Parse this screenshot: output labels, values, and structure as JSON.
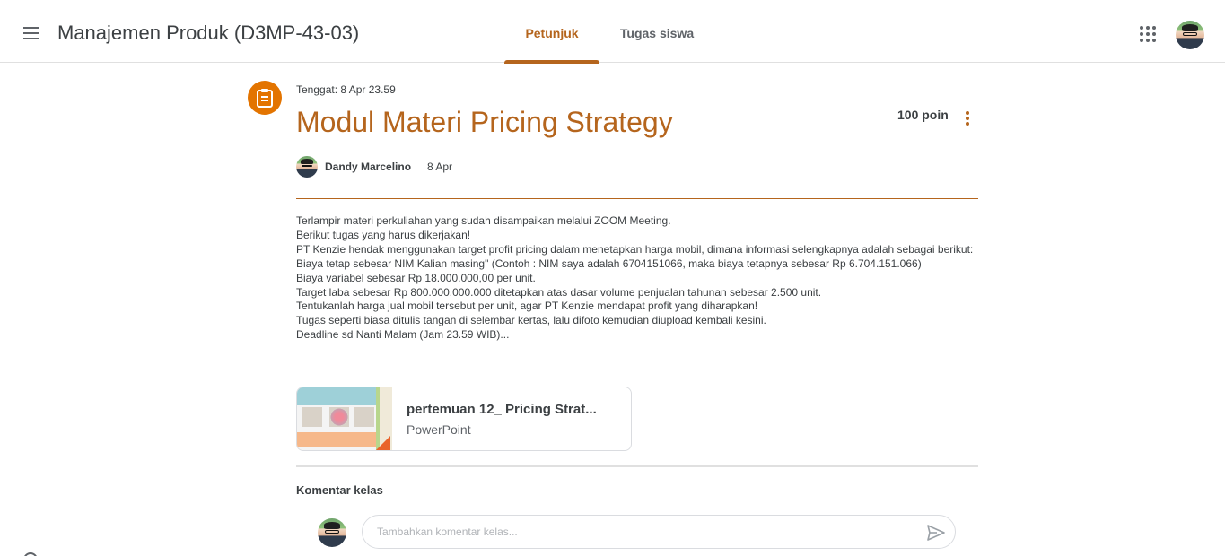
{
  "header": {
    "course_title": "Manajemen Produk (D3MP-43-03)",
    "tabs": [
      {
        "label": "Petunjuk",
        "active": true
      },
      {
        "label": "Tugas siswa",
        "active": false
      }
    ],
    "menu_icon": "hamburger-menu-icon",
    "apps_icon": "apps-grid-icon"
  },
  "assignment": {
    "icon": "assignment-icon",
    "due": "Tenggat: 8 Apr 23.59",
    "title": "Modul Materi Pricing Strategy",
    "points": "100 poin",
    "author": "Dandy Marcelino",
    "date": "8 Apr",
    "body": [
      "Terlampir materi perkuliahan yang sudah disampaikan melalui ZOOM Meeting.",
      "Berikut tugas yang harus dikerjakan!",
      "PT Kenzie hendak menggunakan target profit pricing dalam menetapkan harga mobil, dimana informasi selengkapnya adalah sebagai berikut:",
      "Biaya tetap sebesar NIM Kalian masing\" (Contoh : NIM saya adalah 6704151066, maka biaya tetapnya sebesar Rp 6.704.151.066)",
      "Biaya variabel sebesar Rp 18.000.000,00 per unit.",
      "Target laba sebesar Rp 800.000.000.000 ditetapkan atas dasar volume penjualan tahunan sebesar 2.500 unit.",
      "Tentukanlah harga jual mobil tersebut per unit, agar PT Kenzie mendapat profit yang diharapkan!",
      "",
      "Tugas seperti biasa ditulis tangan di selembar kertas, lalu difoto kemudian diupload kembali kesini.",
      "Deadline sd Nanti Malam (Jam 23.59 WIB)..."
    ]
  },
  "attachment": {
    "title": "pertemuan 12_ Pricing Strat...",
    "type": "PowerPoint"
  },
  "comments": {
    "label": "Komentar kelas",
    "placeholder": "Tambahkan komentar kelas...",
    "send_icon": "send-icon"
  },
  "colors": {
    "accent": "#b5651d",
    "icon_bg": "#e37400",
    "text": "#3c4043",
    "border": "#dadce0"
  }
}
